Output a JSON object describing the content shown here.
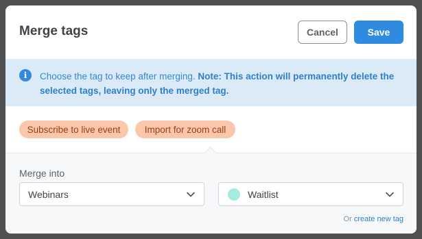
{
  "modal": {
    "title": "Merge tags",
    "cancel_label": "Cancel",
    "save_label": "Save"
  },
  "notice": {
    "icon": "info-icon",
    "icon_glyph": "i",
    "text": "Choose the tag to keep after merging.",
    "bold_text": "Note: This action will permanently delete the selected tags, leaving only the merged tag."
  },
  "selected_tags": [
    {
      "label": "Subscribe to live event",
      "color": "#fbc7ab"
    },
    {
      "label": "Import for zoom call",
      "color": "#fbc7ab"
    }
  ],
  "merge": {
    "label": "Merge into",
    "left_select": {
      "value": "Webinars"
    },
    "right_select": {
      "value": "Waitlist",
      "swatch_color": "#a6ebe0"
    },
    "create_prefix": "Or",
    "create_link": "create new tag"
  },
  "colors": {
    "accent": "#2f8be0",
    "notice_bg": "#dbeaf7",
    "tag_bg": "#fbc7ab"
  }
}
